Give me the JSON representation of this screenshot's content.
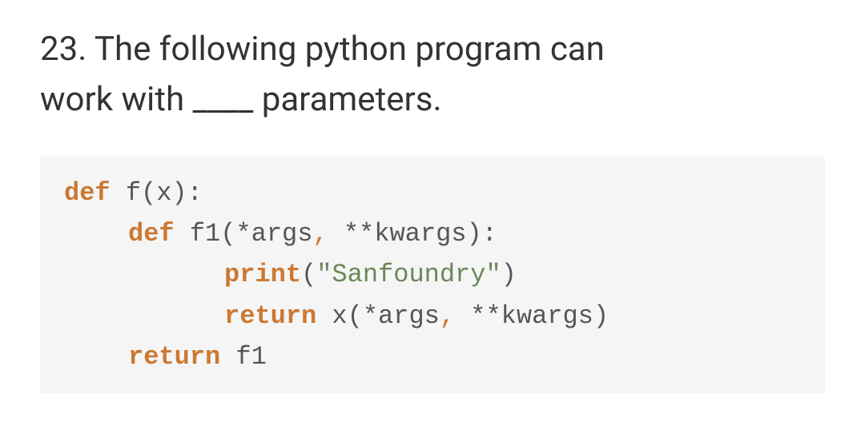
{
  "question": {
    "number": "23.",
    "text_part1": "The following python program can",
    "text_part2": "work with ____ parameters."
  },
  "code": {
    "line1": {
      "def": "def",
      "rest": " f(x):"
    },
    "line2": {
      "def": "def",
      "rest1": " f1(*args",
      "comma": ",",
      "rest2": " **kwargs):"
    },
    "line3": {
      "print": "print",
      "paren1": "(",
      "string": "\"Sanfoundry\"",
      "paren2": ")"
    },
    "line4": {
      "return": "return",
      "rest1": " x(*args",
      "comma": ",",
      "rest2": " **kwargs)"
    },
    "line5": {
      "return": "return",
      "rest": " f1"
    }
  }
}
